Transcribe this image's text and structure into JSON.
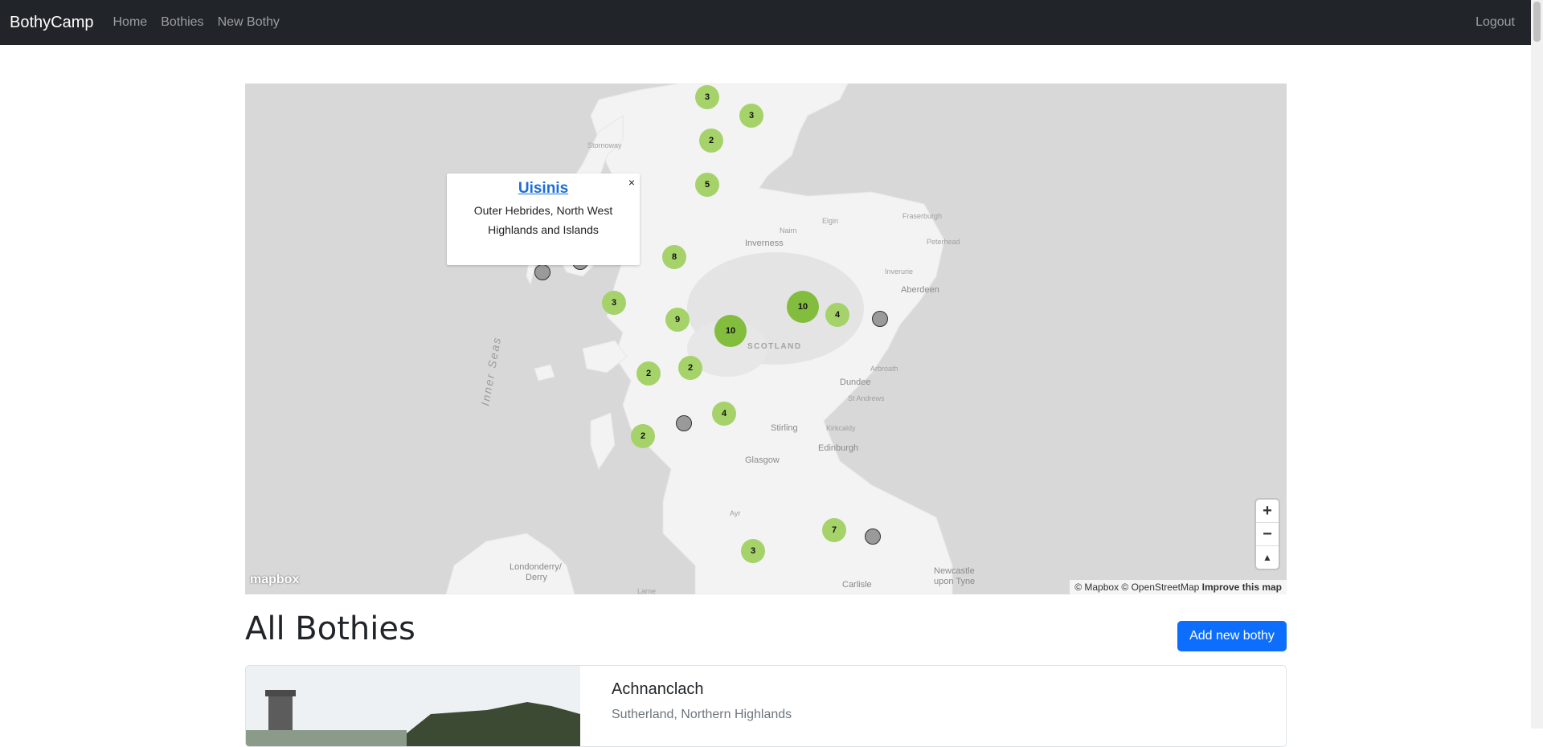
{
  "navbar": {
    "brand": "BothyCamp",
    "links": [
      {
        "label": "Home"
      },
      {
        "label": "Bothies"
      },
      {
        "label": "New Bothy"
      }
    ],
    "logout": "Logout"
  },
  "map": {
    "places": {
      "stornoway": "Stornoway",
      "inverness": "Inverness",
      "nairn": "Nairn",
      "elgin": "Elgin",
      "fraserburgh": "Fraserburgh",
      "peterhead": "Peterhead",
      "inverurie": "Inverurie",
      "aberdeen": "Aberdeen",
      "scotland": "SCOTLAND",
      "inner_seas": "Inner Seas",
      "arbroath": "Arbroath",
      "dundee": "Dundee",
      "st_andrews": "St Andrews",
      "stirling": "Stirling",
      "kirkcaldy": "Kirkcaldy",
      "edinburgh": "Edinburgh",
      "glasgow": "Glasgow",
      "ayr": "Ayr",
      "londonderry": "Londonderry/",
      "derry": "Derry",
      "larne": "Larne",
      "carlisle": "Carlisle",
      "newcastle": "Newcastle",
      "upon_tyne": "upon Tyne"
    },
    "clusters": [
      {
        "count": "3"
      },
      {
        "count": "3"
      },
      {
        "count": "2"
      },
      {
        "count": "5"
      },
      {
        "count": "8"
      },
      {
        "count": "3"
      },
      {
        "count": "9"
      },
      {
        "count": "10"
      },
      {
        "count": "10"
      },
      {
        "count": "4"
      },
      {
        "count": "2"
      },
      {
        "count": "2"
      },
      {
        "count": "4"
      },
      {
        "count": "2"
      },
      {
        "count": "7"
      },
      {
        "count": "3"
      }
    ],
    "popup": {
      "title": "Uisinis",
      "description": "Outer Hebrides, North West Highlands and Islands",
      "close": "×"
    },
    "controls": {
      "zoom_in": "+",
      "zoom_out": "−",
      "compass": "▲"
    },
    "logo": "mapbox",
    "attribution": {
      "text": "© Mapbox © OpenStreetMap",
      "improve": "Improve this map"
    }
  },
  "page": {
    "title": "All Bothies",
    "add_button": "Add new bothy"
  },
  "bothies": [
    {
      "name": "Achnanclach",
      "region": "Sutherland, Northern Highlands"
    }
  ],
  "colors": {
    "navbar": "#212529",
    "primary": "#0d6efd",
    "cluster_small": "#a6d26a",
    "cluster_large": "#82bd3d",
    "map_sea": "#d8d8d8",
    "map_land": "#f3f3f3"
  }
}
